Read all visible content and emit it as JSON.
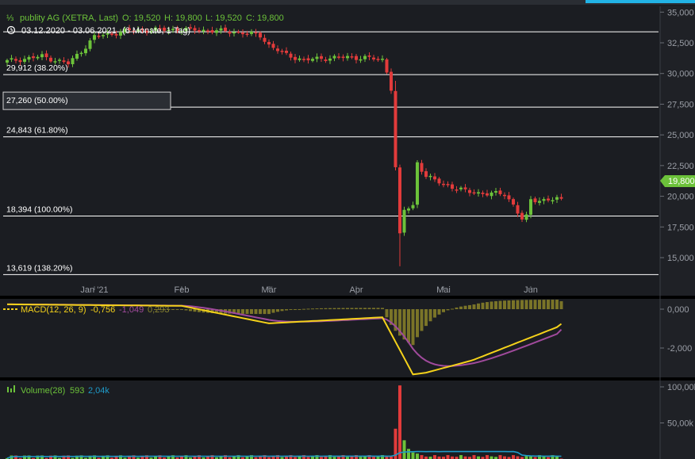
{
  "header": {
    "icon": "candlestick-icon",
    "symbol": "publity AG (XETRA, Last)",
    "ohlc": {
      "open": "O: 19,520",
      "high": "H: 19,800",
      "low": "L: 19,520",
      "close": "C: 19,800"
    },
    "range": "03.12.2020 - 03.06.2021",
    "period": "(6 Monate, 1 Tag)"
  },
  "colors": {
    "up": "#6cc23a",
    "down": "#e23b3b",
    "macd": "#f5d21a",
    "signal": "#a04a9c",
    "hist": "#7a7428",
    "volume_avg": "#1e9bc9",
    "badge": "#6cc23a"
  },
  "price_badge": "19,800",
  "chart_data": [
    {
      "type": "candlestick",
      "title": "publity AG (XETRA, Last)",
      "y_ticks": [
        "35,000",
        "32,500",
        "30,000",
        "27,500",
        "25,000",
        "22,500",
        "20,000",
        "17,500",
        "15,000"
      ],
      "y_tick_values": [
        35000,
        32500,
        30000,
        27500,
        25000,
        22500,
        20000,
        17500,
        15000
      ],
      "ylim": [
        13300,
        35500
      ],
      "x_labels": [
        "Jan '21",
        "Feb",
        "Mär",
        "Apr",
        "Mai",
        "Jun"
      ],
      "x_label_positions": [
        20,
        40,
        60,
        80,
        100,
        120
      ],
      "n_bars": 128,
      "fib_levels": [
        {
          "label": "29,912 (38.20%)",
          "value": 29912,
          "highlight": false
        },
        {
          "label": "27,260 (50.00%)",
          "value": 27260,
          "highlight": true
        },
        {
          "label": "24,843 (61.80%)",
          "value": 24843,
          "highlight": false
        },
        {
          "label": "18,394 (100.00%)",
          "value": 18394,
          "highlight": false
        },
        {
          "label": "13,619 (138.20%)",
          "value": 13619,
          "highlight": false
        }
      ],
      "top_line_value": 33400,
      "last_price": 19800,
      "grid": false
    },
    {
      "type": "line",
      "title": "MACD(12, 26, 9)",
      "values_text": [
        "-0,756",
        "-1,049",
        "0,293"
      ],
      "y_ticks": [
        "0,000",
        "-2,000"
      ],
      "y_tick_values": [
        0,
        -2
      ],
      "ylim": [
        -3.3,
        0.5
      ]
    },
    {
      "type": "bar",
      "title": "Volume(28)",
      "values_text": [
        "593",
        "2,04k"
      ],
      "y_ticks": [
        "100,00k",
        "50,00k"
      ],
      "y_tick_values": [
        100000,
        50000
      ],
      "ylim": [
        0,
        102000
      ]
    }
  ]
}
